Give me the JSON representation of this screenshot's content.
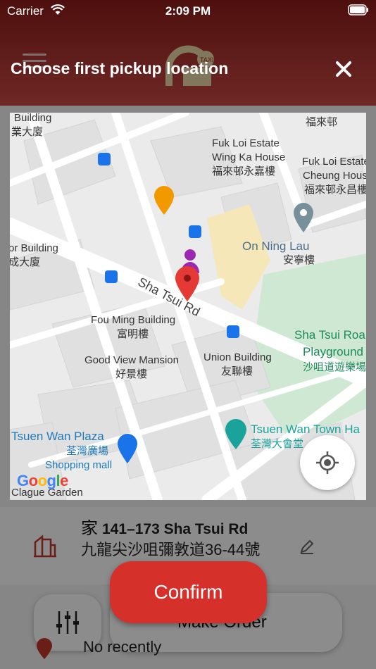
{
  "status_bar": {
    "carrier": "Carrier",
    "time": "2:09 PM"
  },
  "modal": {
    "title": "Choose first pickup location",
    "confirm_label": "Confirm"
  },
  "map": {
    "road_label": "Sha Tsui Rd",
    "labels": [
      {
        "id": "building-top-left",
        "text": "Building"
      },
      {
        "id": "building-top-left-cjk",
        "text": "業大廈"
      },
      {
        "id": "fuk-loi-cjk-top",
        "text": "福來邨"
      },
      {
        "id": "fuk-loi-estate-wing-ka",
        "text": "Fuk Loi Estate"
      },
      {
        "id": "wing-ka-house",
        "text": "Wing Ka House"
      },
      {
        "id": "wing-ka-cjk",
        "text": "福來邨永嘉樓"
      },
      {
        "id": "fuk-loi-estate-right",
        "text": "Fuk Loi Estate Wi"
      },
      {
        "id": "cheung-house",
        "text": "Cheung Hous"
      },
      {
        "id": "cheung-cjk",
        "text": "福來邨永昌樓"
      },
      {
        "id": "or-building",
        "text": "or Building"
      },
      {
        "id": "or-building-cjk",
        "text": "成大廈"
      },
      {
        "id": "on-ning-lau",
        "text": "On Ning Lau"
      },
      {
        "id": "on-ning-cjk",
        "text": "安寧樓"
      },
      {
        "id": "fou-ming",
        "text": "Fou Ming Building"
      },
      {
        "id": "fou-ming-cjk",
        "text": "富明樓"
      },
      {
        "id": "good-view",
        "text": "Good View Mansion"
      },
      {
        "id": "good-view-cjk",
        "text": "好景樓"
      },
      {
        "id": "union-building",
        "text": "Union Building"
      },
      {
        "id": "union-cjk",
        "text": "友聯樓"
      },
      {
        "id": "sha-tsui-road",
        "text": "Sha Tsui Roa"
      },
      {
        "id": "playground",
        "text": "Playground"
      },
      {
        "id": "playground-cjk",
        "text": "沙咀道遊樂場"
      },
      {
        "id": "tsuen-wan-plaza",
        "text": "Tsuen Wan Plaza"
      },
      {
        "id": "tsuen-wan-plaza-cjk",
        "text": "荃灣廣場"
      },
      {
        "id": "shopping-mall",
        "text": "Shopping mall"
      },
      {
        "id": "town-hall",
        "text": "Tsuen Wan Town Ha"
      },
      {
        "id": "town-hall-cjk",
        "text": "荃灣大會堂"
      },
      {
        "id": "clague",
        "text": "Clague Garden"
      }
    ],
    "google_logo": "Google",
    "colors": {
      "pin": "#e53935",
      "person": "#9c27b0",
      "bus": "#1a73e8",
      "food": "#f29900",
      "park": "#cfe8d3"
    }
  },
  "app_behind": {
    "place_name": "家",
    "place_title": "141–173 Sha Tsui Rd",
    "place_address": "九龍尖沙咀彌敦道36-44號",
    "make_order_label": "Make Order",
    "recently_label": "No recently"
  },
  "colors": {
    "brand_red": "#d6302b",
    "header_dark_red": "#8e1d1a"
  }
}
